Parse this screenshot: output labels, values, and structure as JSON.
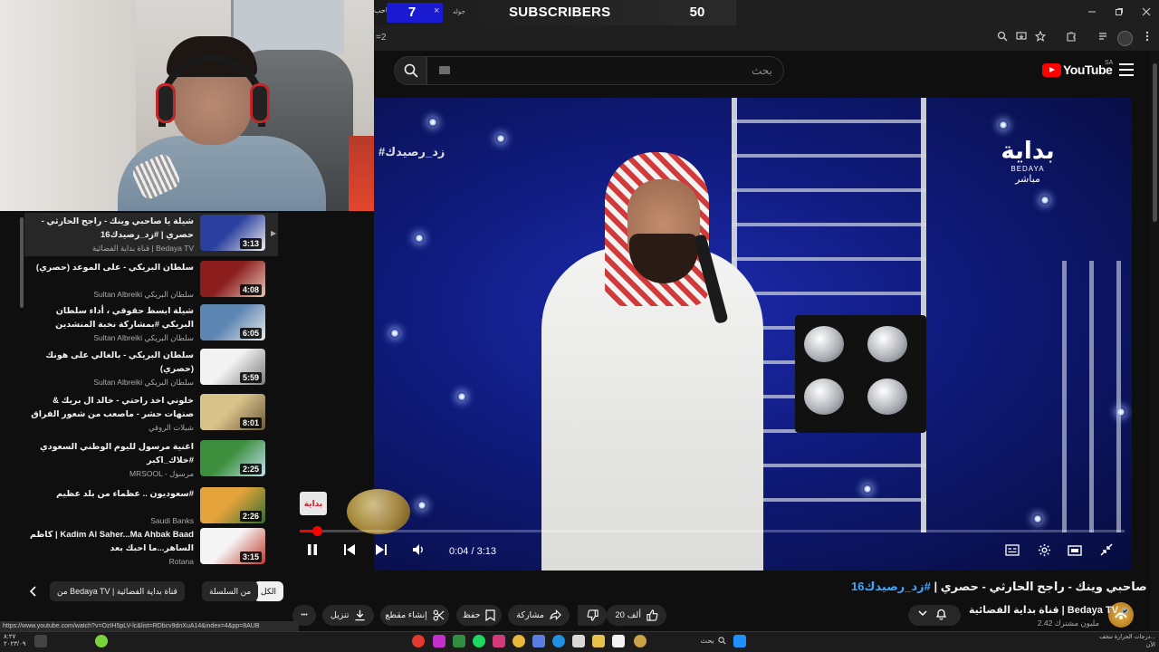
{
  "overlay": {
    "subscriber_current": "7",
    "subscriber_title": "SUBSCRIBERS",
    "subscriber_goal": "50",
    "left_label": "ا صاحب",
    "close_glyph": "×",
    "small_label": "جوله"
  },
  "browser": {
    "url_fragment": "=2"
  },
  "youtube": {
    "search_placeholder": "بحث",
    "logo_text": "YouTube",
    "country_code": "SA"
  },
  "player": {
    "current_time": "0:04",
    "duration": "3:13",
    "time_display": "0:04 / 3:13",
    "progress_fraction": 0.0207,
    "hashtag_overlay": "#زد_رصيدك",
    "channel_bug_logo": "بداية",
    "channel_bug_name": "BEDAYA",
    "channel_bug_live": "مباشر",
    "watermark": "بداية"
  },
  "playlist": {
    "items": [
      {
        "title": "شيلة يا صاحبي وينك - راجح الحارثي - حصري | #زد_رصيدك16",
        "channel": "قناة بداية الفضائية | Bedaya TV",
        "duration": "3:13",
        "active": true,
        "thumb_colors": [
          "#2b3f9e",
          "#eeeeee"
        ]
      },
      {
        "title": "سلطان البريكي - على الموعد (حصري)",
        "channel": "Sultan Albreiki سلطان البريكي",
        "duration": "4:08",
        "active": false,
        "thumb_colors": [
          "#8c1d1d",
          "#e6c7b6"
        ]
      },
      {
        "title": "شيلة ابسط حقوقي ، أداء سلطان البريكي #بمشاركة نخبة المنشدين والشعار",
        "channel": "Sultan Albreiki سلطان البريكي",
        "duration": "6:05",
        "active": false,
        "thumb_colors": [
          "#5e86b3",
          "#e8e8e8"
        ]
      },
      {
        "title": "سلطان البريكي - بالغالي على هونك (حصري)",
        "channel": "Sultan Albreiki سلطان البريكي",
        "duration": "5:59",
        "active": false,
        "thumb_colors": [
          "#f2f2f2",
          "#7a7a7a"
        ]
      },
      {
        "title": "خلوني اخذ راحتي - خالد ال بريك & صنهات حشر - ماصعب من شعور الفراق الا شعو...",
        "channel": "شيلات الروقي",
        "duration": "8:01",
        "active": false,
        "thumb_colors": [
          "#d9c28a",
          "#6b5a3a"
        ]
      },
      {
        "title": "اغنية مرسول لليوم الوطني السعودي #خلاك_اكبر",
        "channel": "MRSOOL - مرسول",
        "duration": "2:25",
        "active": false,
        "thumb_colors": [
          "#3d8f3d",
          "#bfe0ef"
        ]
      },
      {
        "title": "#سعوديون .. عظماء من بلد عظيم",
        "channel": "Saudi Banks",
        "duration": "2:26",
        "active": false,
        "thumb_colors": [
          "#e5a33b",
          "#2e6d2e"
        ]
      },
      {
        "title": "Kadim Al Saher...Ma Ahbak Baad | كاظم الساهر...ما احبك بعد",
        "channel": "Rotana",
        "duration": "3:15",
        "active": false,
        "thumb_colors": [
          "#f4f4f4",
          "#c0392b"
        ]
      }
    ]
  },
  "chips": {
    "all": "الكل",
    "from_series": "من السلسلة",
    "from_channel": "من Bedaya TV | قناة بداية الفضائية"
  },
  "video": {
    "title_main": "شيلة يا صاحبي وينك - راجح الحارثي - حصري | ",
    "title_tag": "#زد_رصيدك16",
    "channel_name": "قناة بداية الفضائية | Bedaya TV",
    "subscribers": "2.42 مليون مشترك",
    "likes": "20 ألف",
    "share": "مشاركة",
    "save": "حفظ",
    "clip": "إنشاء مقطع",
    "download": "تنزيل",
    "more": "•••"
  },
  "status_url": "https://www.youtube.com/watch?v=OzIH5pLV-lc&list=RDbcv9dnXuA14&index=4&pp=8AUB",
  "taskbar": {
    "search_label": "بحث",
    "clock_time": "٨:٢٧",
    "clock_date": "٢٠٢٣/٠٩",
    "tray_line1": "درجات الحرارة تنخف...",
    "tray_line2": "الآن"
  },
  "colors": {
    "accent_red": "#ff0000",
    "link_blue": "#3ea6ff",
    "sub_box_blue": "#1a1ad1",
    "page_bg": "#0f0f0f"
  }
}
